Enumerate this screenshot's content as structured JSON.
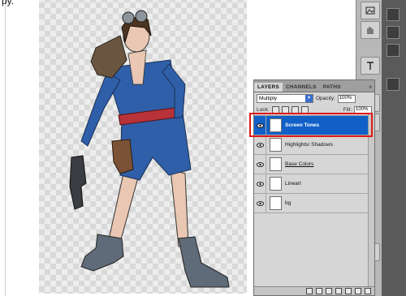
{
  "corner_text": "py.",
  "layers_panel": {
    "tabs": [
      "LAYERS",
      "CHANNELS",
      "PATHS"
    ],
    "menu_glyph": "»",
    "blend_mode": "Multiply",
    "opacity_label": "Opacity:",
    "opacity_value": "100%",
    "lock_label": "Lock:",
    "fill_label": "Fill:",
    "fill_value": "100%",
    "layers": [
      {
        "name": "Screen Tones",
        "selected": true
      },
      {
        "name": "Highlights/ Shadows",
        "selected": false
      },
      {
        "name": "Base Colors",
        "selected": false
      },
      {
        "name": "Lineart",
        "selected": false
      },
      {
        "name": "bg",
        "selected": false
      }
    ]
  },
  "tool_icons": [
    "image-icon",
    "hand-icon",
    "text-icon",
    "brush-icon",
    "tool-icon",
    "tool-icon"
  ],
  "colors": {
    "selection_blue": "#1060c8",
    "highlight_red": "#e01818",
    "suit_blue": "#2f5fa8",
    "belt_red": "#b8323a"
  }
}
